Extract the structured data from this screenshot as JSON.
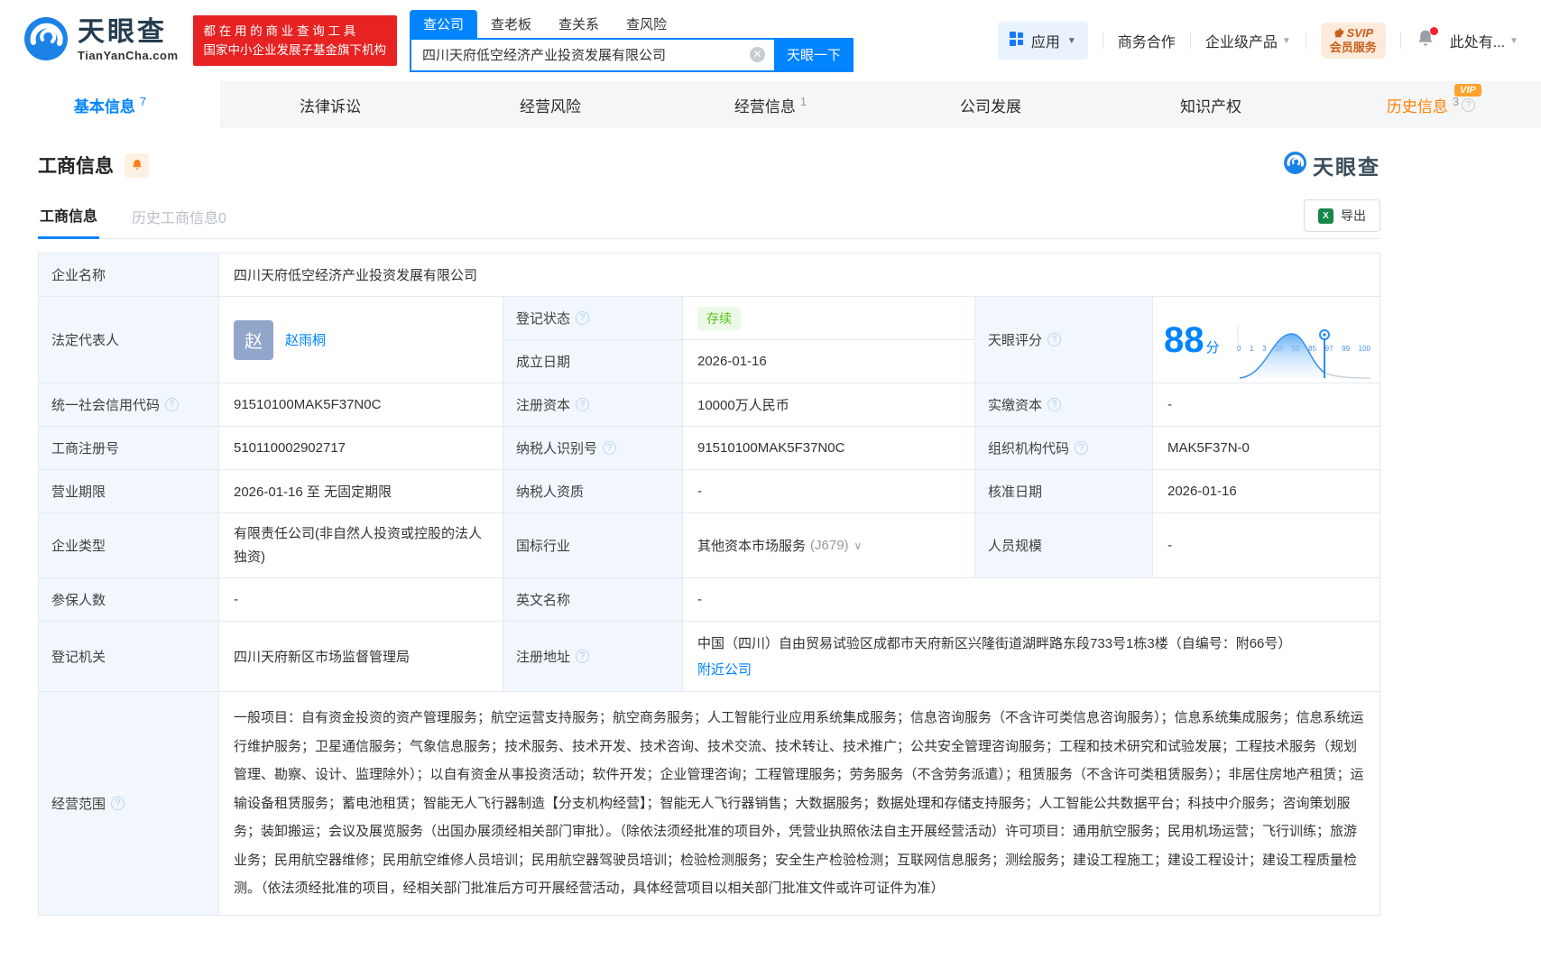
{
  "header": {
    "logo": {
      "name": "天眼查",
      "domain": "TianYanCha.com"
    },
    "promo": {
      "line1": "都 在 用 的 商 业 查 询 工 具",
      "line2": "国家中小企业发展子基金旗下机构"
    },
    "search": {
      "tabs": [
        {
          "label": "查公司"
        },
        {
          "label": "查老板"
        },
        {
          "label": "查关系"
        },
        {
          "label": "查风险"
        }
      ],
      "value": "四川天府低空经济产业投资发展有限公司",
      "button": "天眼一下"
    },
    "menu": {
      "apps": "应用",
      "cooperation": "商务合作",
      "enterprise": "企业级产品",
      "svip_top": "SVIP",
      "svip_bottom": "会员服务",
      "user": "此处有..."
    }
  },
  "nav": {
    "tabs": [
      {
        "label": "基本信息",
        "count": "7"
      },
      {
        "label": "法律诉讼",
        "count": ""
      },
      {
        "label": "经营风险",
        "count": ""
      },
      {
        "label": "经营信息",
        "count": "1"
      },
      {
        "label": "公司发展",
        "count": ""
      },
      {
        "label": "知识产权",
        "count": ""
      },
      {
        "label": "历史信息",
        "count": "3",
        "vip": "VIP"
      }
    ]
  },
  "section": {
    "title": "工商信息",
    "watermark": "天眼查",
    "subtabs": [
      {
        "label": "工商信息"
      },
      {
        "label": "历史工商信息0"
      }
    ],
    "export_label": "导出"
  },
  "info": {
    "name": {
      "label": "企业名称",
      "value": "四川天府低空经济产业投资发展有限公司"
    },
    "legal": {
      "label": "法定代表人",
      "avatar": "赵",
      "person": "赵雨桐"
    },
    "status": {
      "label": "登记状态",
      "value": "存续"
    },
    "established": {
      "label": "成立日期",
      "value": "2026-01-16"
    },
    "score": {
      "label": "天眼评分",
      "value": "88",
      "unit": "分",
      "axis": [
        "0",
        "1",
        "3",
        "15",
        "50",
        "85",
        "97",
        "99",
        "100"
      ]
    },
    "credit_code": {
      "label": "统一社会信用代码",
      "value": "91510100MAK5F37N0C"
    },
    "reg_capital": {
      "label": "注册资本",
      "value": "10000万人民币"
    },
    "paid_capital": {
      "label": "实缴资本",
      "value": "-"
    },
    "reg_number": {
      "label": "工商注册号",
      "value": "510110002902717"
    },
    "taxpayer_id": {
      "label": "纳税人识别号",
      "value": "91510100MAK5F37N0C"
    },
    "org_code": {
      "label": "组织机构代码",
      "value": "MAK5F37N-0"
    },
    "term": {
      "label": "营业期限",
      "value": "2026-01-16 至 无固定期限"
    },
    "taxpayer_quality": {
      "label": "纳税人资质",
      "value": "-"
    },
    "approval_date": {
      "label": "核准日期",
      "value": "2026-01-16"
    },
    "company_type": {
      "label": "企业类型",
      "value": "有限责任公司(非自然人投资或控股的法人独资)"
    },
    "industry": {
      "label": "国标行业",
      "value": "其他资本市场服务",
      "code": "(J679)"
    },
    "staff_size": {
      "label": "人员规模",
      "value": "-"
    },
    "insured": {
      "label": "参保人数",
      "value": "-"
    },
    "english_name": {
      "label": "英文名称",
      "value": "-"
    },
    "authority": {
      "label": "登记机关",
      "value": "四川天府新区市场监督管理局"
    },
    "address": {
      "label": "注册地址",
      "value": "中国（四川）自由贸易试验区成都市天府新区兴隆街道湖畔路东段733号1栋3楼（自编号：附66号）",
      "link": "附近公司"
    },
    "scope": {
      "label": "经营范围",
      "value": "一般项目：自有资金投资的资产管理服务；航空运营支持服务；航空商务服务；人工智能行业应用系统集成服务；信息咨询服务（不含许可类信息咨询服务）；信息系统集成服务；信息系统运行维护服务；卫星通信服务；气象信息服务；技术服务、技术开发、技术咨询、技术交流、技术转让、技术推广；公共安全管理咨询服务；工程和技术研究和试验发展；工程技术服务（规划管理、勘察、设计、监理除外）；以自有资金从事投资活动；软件开发；企业管理咨询；工程管理服务；劳务服务（不含劳务派遣）；租赁服务（不含许可类租赁服务）；非居住房地产租赁；运输设备租赁服务；蓄电池租赁；智能无人飞行器制造【分支机构经营】；智能无人飞行器销售；大数据服务；数据处理和存储支持服务；人工智能公共数据平台；科技中介服务；咨询策划服务；装卸搬运；会议及展览服务（出国办展须经相关部门审批）。（除依法须经批准的项目外，凭营业执照依法自主开展经营活动）许可项目：通用航空服务；民用机场运营；飞行训练；旅游业务；民用航空器维修；民用航空维修人员培训；民用航空器驾驶员培训；检验检测服务；安全生产检验检测；互联网信息服务；测绘服务；建设工程施工；建设工程设计；建设工程质量检测。（依法须经批准的项目，经相关部门批准后方可开展经营活动，具体经营项目以相关部门批准文件或许可证件为准）"
    }
  },
  "colors": {
    "primary": "#0084ff",
    "promo_red": "#e62222",
    "history_orange": "#ff8000",
    "status_green": "#52c41a"
  }
}
